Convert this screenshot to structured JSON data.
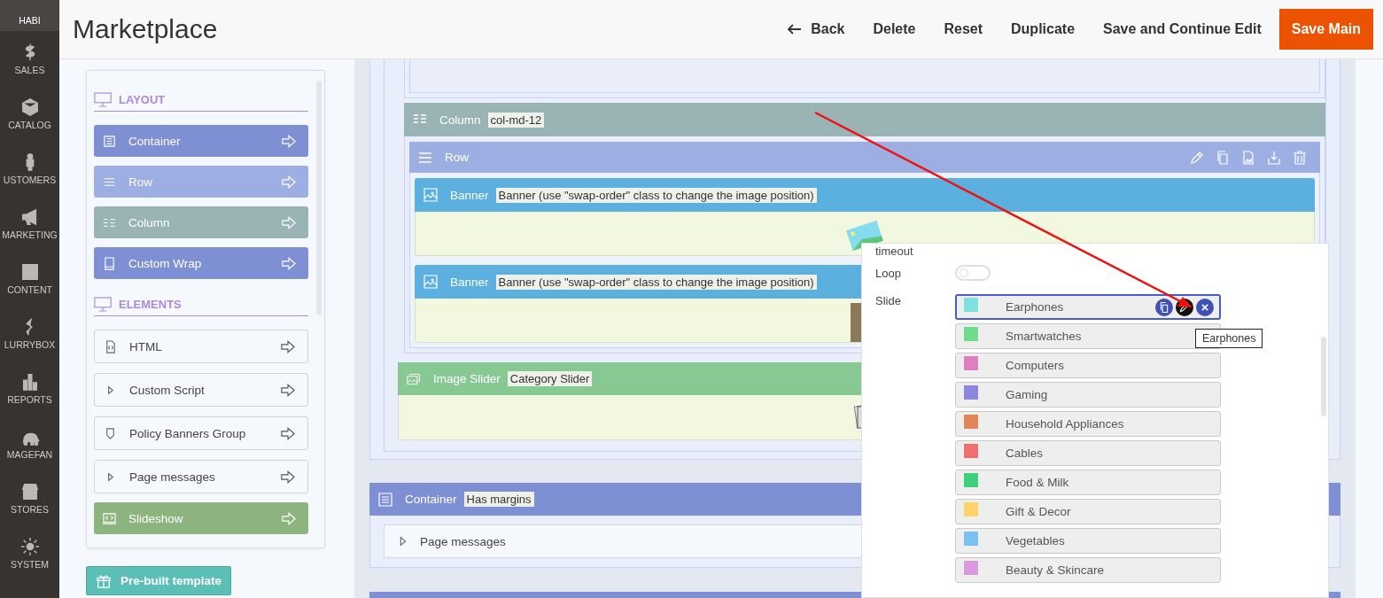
{
  "nav": {
    "items": [
      {
        "label": "HABI",
        "kind": "logo"
      },
      {
        "label": "SALES",
        "kind": "link"
      },
      {
        "label": "CATALOG",
        "kind": "link"
      },
      {
        "label": "USTOMERS",
        "kind": "link"
      },
      {
        "label": "MARKETING",
        "kind": "link"
      },
      {
        "label": "CONTENT",
        "kind": "link"
      },
      {
        "label": "LURRYBOX",
        "kind": "link"
      },
      {
        "label": "REPORTS",
        "kind": "link"
      },
      {
        "label": "MAGEFAN",
        "kind": "link"
      },
      {
        "label": "STORES",
        "kind": "link"
      },
      {
        "label": "SYSTEM",
        "kind": "link"
      }
    ]
  },
  "header": {
    "title": "Marketplace",
    "actions": [
      {
        "label": "Back",
        "kind": "back"
      },
      {
        "label": "Delete",
        "kind": "text"
      },
      {
        "label": "Reset",
        "kind": "text"
      },
      {
        "label": "Duplicate",
        "kind": "text"
      },
      {
        "label": "Save and Continue Edit",
        "kind": "text"
      },
      {
        "label": "Save Main",
        "kind": "primary"
      }
    ]
  },
  "palette": {
    "sections": [
      {
        "title": "LAYOUT",
        "items": [
          {
            "label": "Container",
            "kind": "filled",
            "color": "#7f8fd4"
          },
          {
            "label": "Row",
            "kind": "filled",
            "color": "#9daee2"
          },
          {
            "label": "Column",
            "kind": "filled",
            "color": "#9ab3b5"
          },
          {
            "label": "Custom Wrap",
            "kind": "filled",
            "color": "#7f8fd4"
          }
        ]
      },
      {
        "title": "ELEMENTS",
        "items": [
          {
            "label": "HTML",
            "kind": "outline"
          },
          {
            "label": "Custom Script",
            "kind": "outline"
          },
          {
            "label": "Policy Banners Group",
            "kind": "outline"
          },
          {
            "label": "Page messages",
            "kind": "outline"
          },
          {
            "label": "Slideshow",
            "kind": "filled",
            "color": "#8db47f"
          }
        ]
      }
    ],
    "template_button": "Pre-built template"
  },
  "canvas": {
    "column": {
      "label": "Column",
      "tag": "col-md-12"
    },
    "row": {
      "label": "Row"
    },
    "banners": [
      {
        "label": "Banner",
        "tag": "Banner (use \"swap-order\" class to change the image position)",
        "kind": "graphic"
      },
      {
        "label": "Banner",
        "tag": "Banner (use \"swap-order\" class to change the image position)",
        "kind": "photo"
      }
    ],
    "image_slider": {
      "label": "Image Slider",
      "tag": "Category Slider"
    },
    "container": {
      "label": "Container",
      "tag": "Has margins",
      "child": "Page messages"
    }
  },
  "settings": {
    "timeout_label": "timeout",
    "loop": {
      "label": "Loop",
      "on": false
    },
    "slide_label": "Slide",
    "slides": [
      {
        "label": "Earphones",
        "color": "#7fe0e0",
        "selected": true
      },
      {
        "label": "Smartwatches",
        "color": "#6fdc8c",
        "selected": false
      },
      {
        "label": "Computers",
        "color": "#e07fc0",
        "selected": false
      },
      {
        "label": "Gaming",
        "color": "#8b86e0",
        "selected": false
      },
      {
        "label": "Household Appliances",
        "color": "#e0875a",
        "selected": false
      },
      {
        "label": "Cables",
        "color": "#f07070",
        "selected": false
      },
      {
        "label": "Food & Milk",
        "color": "#3ecf7a",
        "selected": false
      },
      {
        "label": "Gift & Decor",
        "color": "#ffd36a",
        "selected": false
      },
      {
        "label": "Vegetables",
        "color": "#7ac0f0",
        "selected": false
      },
      {
        "label": "Beauty & Skincare",
        "color": "#d99ae0",
        "selected": false
      }
    ],
    "tooltip": "Earphones"
  }
}
